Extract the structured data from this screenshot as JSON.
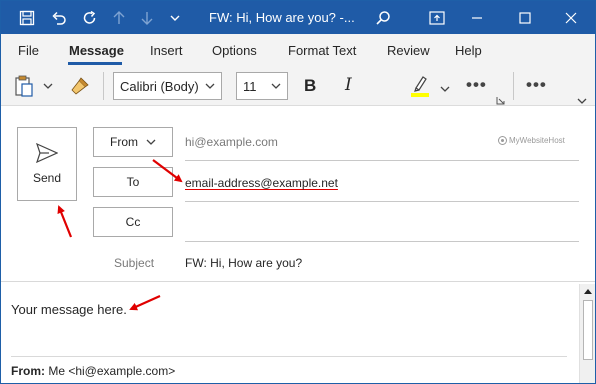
{
  "window": {
    "title": "FW: Hi, How are you?  -...",
    "colors": {
      "titlebar": "#1f5ba7",
      "accent": "#1f5ba7",
      "annotation": "#e00000"
    }
  },
  "menu": {
    "items": [
      "File",
      "Message",
      "Insert",
      "Options",
      "Format Text",
      "Review",
      "Help"
    ],
    "active": "Message"
  },
  "ribbon": {
    "font_name": "Calibri (Body)",
    "font_size": "11",
    "bold": "B",
    "italic": "I",
    "more": "•••"
  },
  "compose": {
    "send_label": "Send",
    "from_label": "From",
    "from_value": "hi@example.com",
    "to_label": "To",
    "to_value": "email-address@example.net",
    "cc_label": "Cc",
    "cc_value": "",
    "subject_label": "Subject",
    "subject_value": "FW: Hi, How are you?",
    "watermark": "MyWebsiteHost"
  },
  "body": {
    "message": "Your message here.",
    "from_prefix": "From:",
    "from_value": " Me <hi@example.com>"
  }
}
